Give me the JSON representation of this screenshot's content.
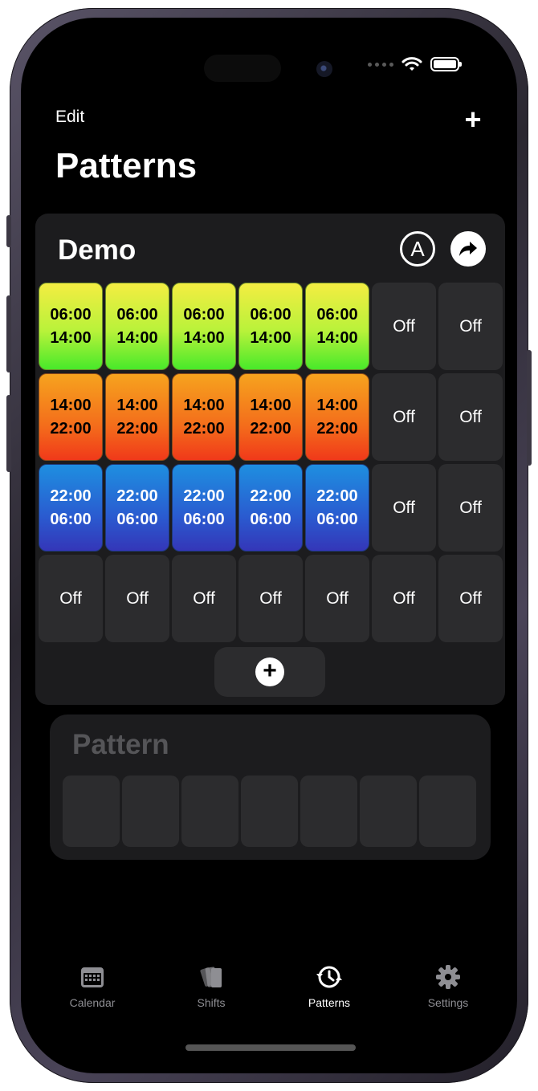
{
  "nav": {
    "edit_label": "Edit",
    "add_label": "+",
    "title": "Patterns"
  },
  "card": {
    "title": "Demo",
    "auto_icon_letter": "A",
    "rows": [
      [
        {
          "type": "green",
          "l1": "06:00",
          "l2": "14:00"
        },
        {
          "type": "green",
          "l1": "06:00",
          "l2": "14:00"
        },
        {
          "type": "green",
          "l1": "06:00",
          "l2": "14:00"
        },
        {
          "type": "green",
          "l1": "06:00",
          "l2": "14:00"
        },
        {
          "type": "green",
          "l1": "06:00",
          "l2": "14:00"
        },
        {
          "type": "off",
          "l1": "Off"
        },
        {
          "type": "off",
          "l1": "Off"
        }
      ],
      [
        {
          "type": "orange",
          "l1": "14:00",
          "l2": "22:00"
        },
        {
          "type": "orange",
          "l1": "14:00",
          "l2": "22:00"
        },
        {
          "type": "orange",
          "l1": "14:00",
          "l2": "22:00"
        },
        {
          "type": "orange",
          "l1": "14:00",
          "l2": "22:00"
        },
        {
          "type": "orange",
          "l1": "14:00",
          "l2": "22:00"
        },
        {
          "type": "off",
          "l1": "Off"
        },
        {
          "type": "off",
          "l1": "Off"
        }
      ],
      [
        {
          "type": "blue",
          "l1": "22:00",
          "l2": "06:00"
        },
        {
          "type": "blue",
          "l1": "22:00",
          "l2": "06:00"
        },
        {
          "type": "blue",
          "l1": "22:00",
          "l2": "06:00"
        },
        {
          "type": "blue",
          "l1": "22:00",
          "l2": "06:00"
        },
        {
          "type": "blue",
          "l1": "22:00",
          "l2": "06:00"
        },
        {
          "type": "off",
          "l1": "Off"
        },
        {
          "type": "off",
          "l1": "Off"
        }
      ],
      [
        {
          "type": "off",
          "l1": "Off"
        },
        {
          "type": "off",
          "l1": "Off"
        },
        {
          "type": "off",
          "l1": "Off"
        },
        {
          "type": "off",
          "l1": "Off"
        },
        {
          "type": "off",
          "l1": "Off"
        },
        {
          "type": "off",
          "l1": "Off"
        },
        {
          "type": "off",
          "l1": "Off"
        }
      ]
    ],
    "add_week_label": "+"
  },
  "pattern_placeholder": {
    "title": "Pattern",
    "slots": 7
  },
  "tabbar": [
    {
      "label": "Calendar",
      "icon": "calendar-icon",
      "active": false
    },
    {
      "label": "Shifts",
      "icon": "shifts-icon",
      "active": false
    },
    {
      "label": "Patterns",
      "icon": "patterns-icon",
      "active": true
    },
    {
      "label": "Settings",
      "icon": "gear-icon",
      "active": false
    }
  ],
  "colors": {
    "accent_active": "#ffffff",
    "inactive": "#8e8e93",
    "card": "#1c1c1e",
    "cell_off": "#2c2c2e"
  }
}
